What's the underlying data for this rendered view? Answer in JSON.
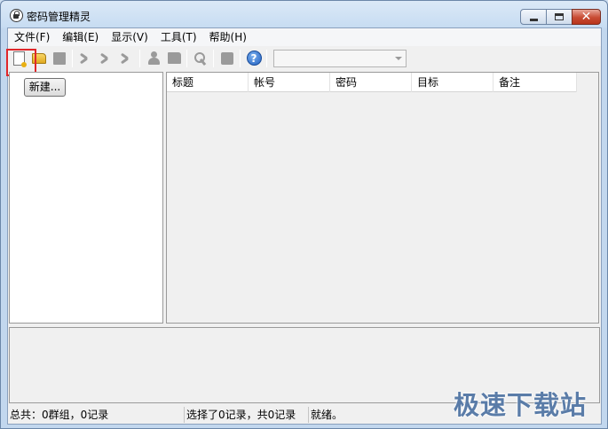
{
  "window": {
    "title": "密码管理精灵",
    "minimize_icon": "minimize-icon",
    "maximize_icon": "maximize-icon",
    "close_icon": "close-icon",
    "close_glyph": "✕"
  },
  "menu": {
    "items": [
      {
        "label": "文件(F)"
      },
      {
        "label": "编辑(E)"
      },
      {
        "label": "显示(V)"
      },
      {
        "label": "工具(T)"
      },
      {
        "label": "帮助(H)"
      }
    ]
  },
  "toolbar": {
    "icons": [
      "new-document-icon",
      "open-folder-icon",
      "save-icon",
      "add-record-icon",
      "edit-record-icon",
      "delete-record-icon",
      "user-icon",
      "book-icon",
      "search-key-icon",
      "stop-icon",
      "help-icon"
    ],
    "help_glyph": "?",
    "combo_value": "",
    "highlight_color": "#e0262a"
  },
  "left_pane": {
    "new_button_label": "新建..."
  },
  "record_table": {
    "columns": [
      "标题",
      "帐号",
      "密码",
      "目标",
      "备注"
    ],
    "rows": []
  },
  "status": {
    "groups_summary": "总共：0群组，0记录",
    "selection_summary": "选择了0记录，共0记录",
    "state": "就绪。"
  },
  "watermark": "极速下载站"
}
